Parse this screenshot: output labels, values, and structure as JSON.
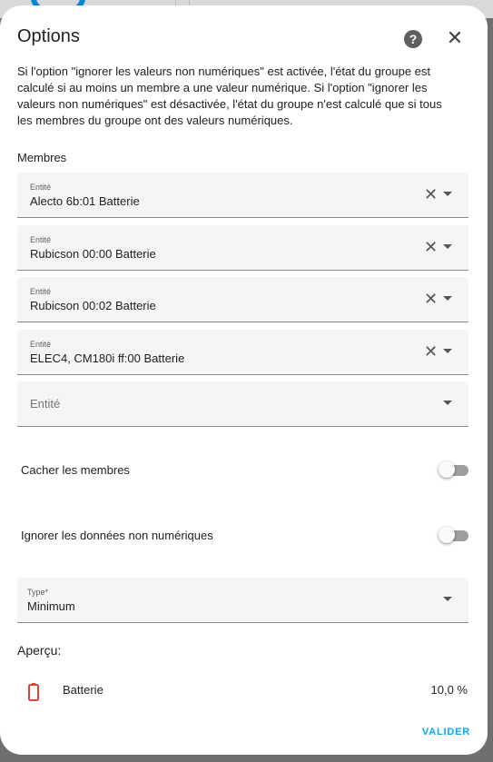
{
  "dialog": {
    "title": "Options",
    "description": "Si l'option \"ignorer les valeurs non numériques\" est activée, l'état du groupe est calculé si au moins un membre a une valeur numérique. Si l'option \"ignorer les valeurs non numériques\" est désactivée, l'état du groupe n'est calculé que si tous les membres du groupe ont des valeurs numériques."
  },
  "members": {
    "label": "Membres",
    "entity_label": "Entité",
    "items": [
      {
        "value": "Alecto 6b:01 Batterie"
      },
      {
        "value": "Rubicson 00:00 Batterie"
      },
      {
        "value": "Rubicson 00:02 Batterie"
      },
      {
        "value": "ELEC4, CM180i ff:00 Batterie"
      }
    ],
    "empty_placeholder": "Entité"
  },
  "toggles": {
    "hide_members": {
      "label": "Cacher les membres",
      "on": false
    },
    "ignore_non_numeric": {
      "label": "Ignorer les données non numériques",
      "on": false
    }
  },
  "type_select": {
    "label": "Type*",
    "value": "Minimum"
  },
  "preview": {
    "label": "Aperçu:",
    "entity_name": "Batterie",
    "value": "10,0 %",
    "icon": "battery-alert-icon",
    "icon_color": "#db4437"
  },
  "actions": {
    "validate_label": "VALIDER"
  },
  "colors": {
    "accent": "#03a9f4"
  }
}
